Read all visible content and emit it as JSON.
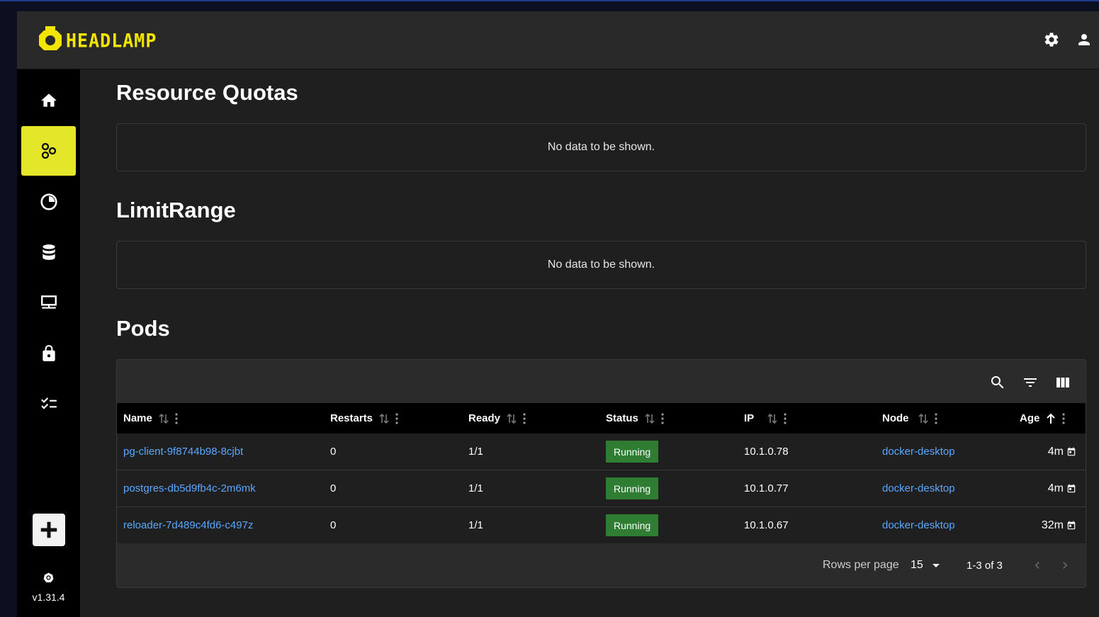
{
  "app": {
    "logo_text": "HEADLAMP",
    "version": "v1.31.4"
  },
  "header": {
    "settings_icon": "gear-icon",
    "user_icon": "person-icon"
  },
  "sidebar": {
    "items": [
      {
        "icon": "home-icon",
        "active": false
      },
      {
        "icon": "cluster-icon",
        "active": true
      },
      {
        "icon": "workloads-pie-icon",
        "active": false
      },
      {
        "icon": "storage-database-icon",
        "active": false
      },
      {
        "icon": "network-icon",
        "active": false
      },
      {
        "icon": "lock-icon",
        "active": false
      },
      {
        "icon": "checklist-icon",
        "active": false
      }
    ],
    "add_icon": "plus-icon",
    "accent": "#e4e62a"
  },
  "sections": {
    "resource_quotas": {
      "title": "Resource Quotas",
      "empty_text": "No data to be shown."
    },
    "limit_range": {
      "title": "LimitRange",
      "empty_text": "No data to be shown."
    },
    "pods": {
      "title": "Pods"
    }
  },
  "pods_table": {
    "columns": [
      "Name",
      "Restarts",
      "Ready",
      "Status",
      "IP",
      "Node",
      "Age"
    ],
    "rows": [
      {
        "name": "pg-client-9f8744b98-8cjbt",
        "restarts": "0",
        "ready": "1/1",
        "status": "Running",
        "ip": "10.1.0.78",
        "node": "docker-desktop",
        "age": "4m"
      },
      {
        "name": "postgres-db5d9fb4c-2m6mk",
        "restarts": "0",
        "ready": "1/1",
        "status": "Running",
        "ip": "10.1.0.77",
        "node": "docker-desktop",
        "age": "4m"
      },
      {
        "name": "reloader-7d489c4fd6-c497z",
        "restarts": "0",
        "ready": "1/1",
        "status": "Running",
        "ip": "10.1.0.67",
        "node": "docker-desktop",
        "age": "32m"
      }
    ],
    "footer": {
      "rows_per_page_label": "Rows per page",
      "rows_per_page_value": "15",
      "range": "1-3 of 3"
    },
    "status_color": "#2e7d32",
    "link_color": "#5aa7ff"
  }
}
